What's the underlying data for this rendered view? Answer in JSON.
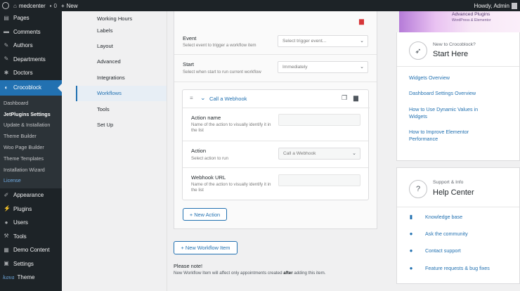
{
  "adminbar": {
    "site_name": "medcenter",
    "comments_count": "0",
    "new_label": "New",
    "howdy": "Howdy, Admin"
  },
  "sidebar": {
    "top_items": [
      {
        "label": "Pages",
        "icon": "pages-icon"
      },
      {
        "label": "Comments",
        "icon": "comments-icon"
      },
      {
        "label": "Authors",
        "icon": "pin-icon"
      },
      {
        "label": "Departments",
        "icon": "pin-icon"
      },
      {
        "label": "Doctors",
        "icon": "gear-icon"
      }
    ],
    "active_item": {
      "label": "Crocoblock",
      "icon": "crocoblock-icon"
    },
    "submenu": [
      "Dashboard",
      "JetPlugins Settings",
      "Update & Installation",
      "Theme Builder",
      "Woo Page Builder",
      "Theme Templates",
      "Installation Wizard",
      "License"
    ],
    "bottom_items": [
      {
        "label": "Appearance",
        "icon": "brush-icon"
      },
      {
        "label": "Plugins",
        "icon": "plugins-icon"
      },
      {
        "label": "Users",
        "icon": "users-icon"
      },
      {
        "label": "Tools",
        "icon": "tools-icon"
      },
      {
        "label": "Demo Content",
        "icon": "demo-icon"
      },
      {
        "label": "Settings",
        "icon": "settings-icon"
      }
    ],
    "theme_logo": "kava",
    "theme_label": "Theme"
  },
  "tabs": [
    {
      "label": "Working Hours"
    },
    {
      "label": "Labels"
    },
    {
      "label": "Layout"
    },
    {
      "label": "Advanced"
    },
    {
      "label": "Integrations"
    },
    {
      "label": "Workflows"
    },
    {
      "label": "Tools"
    },
    {
      "label": "Set Up"
    }
  ],
  "workflow": {
    "event_label": "Event",
    "event_desc": "Select event to trigger a workflow item",
    "event_placeholder": "Select trigger event...",
    "start_label": "Start",
    "start_desc": "Select when start to run current workflow",
    "start_value": "Immediately",
    "action_card": {
      "title": "Call a Webhook",
      "name_label": "Action name",
      "name_desc": "Name of the action to visually identify it in the list",
      "action_label": "Action",
      "action_desc": "Select action to run",
      "action_value": "Call a Webhook",
      "url_label": "Webhook URL",
      "url_desc": "Name of the action to visually identify it in the list"
    },
    "new_action": "+ New Action",
    "new_workflow_item": "+ New Workflow Item",
    "note_title": "Please note!",
    "note_text_before": "New Workflow Item will affect only appointments created ",
    "note_text_bold": "after",
    "note_text_after": " adding this item."
  },
  "right": {
    "promo_title": "Advanced Plugins",
    "promo_sub": "WordPress & Elementor",
    "start_small": "New to Crocoblock?",
    "start_big": "Start Here",
    "start_links": [
      "Widgets Overview",
      "Dashboard Settings Overview",
      "How to Use Dynamic Values in Widgets",
      "How to Improve Elementor Performance"
    ],
    "help_small": "Support & Info",
    "help_big": "Help Center",
    "help_links": [
      {
        "label": "Knowledge base",
        "icon": "book-icon"
      },
      {
        "label": "Ask the community",
        "icon": "facebook-icon"
      },
      {
        "label": "Contact support",
        "icon": "question-icon"
      },
      {
        "label": "Feature requests & bug fixes",
        "icon": "github-icon"
      }
    ]
  },
  "colors": {
    "accent": "#2271b1",
    "admin_dark": "#1d2327",
    "danger": "#d63638"
  }
}
